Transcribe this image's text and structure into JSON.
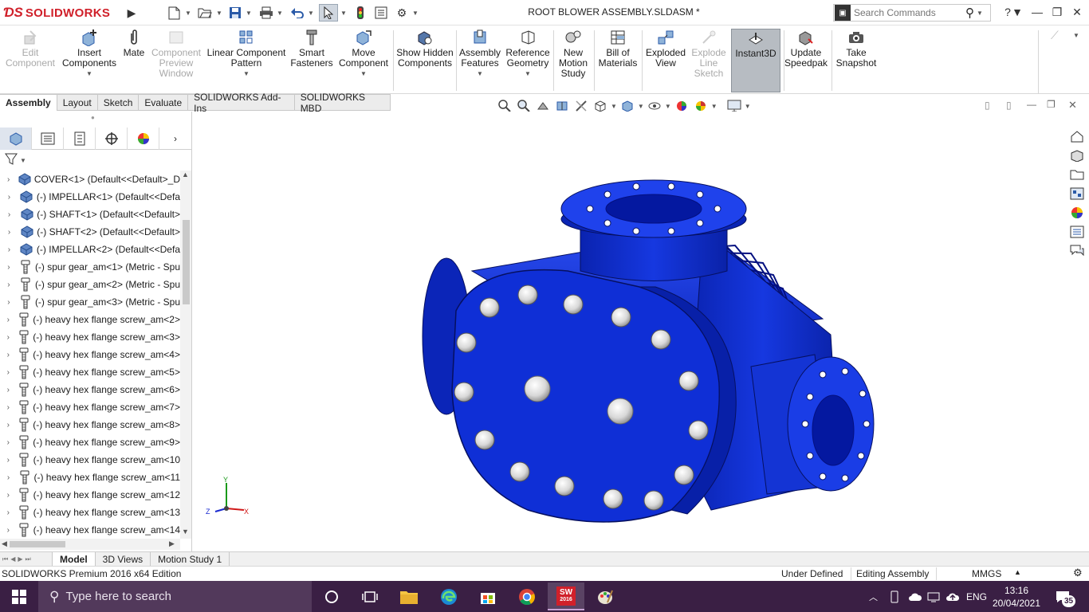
{
  "window": {
    "brand": "SOLIDWORKS",
    "document_title": "ROOT BLOWER ASSEMBLY.SLDASM *",
    "search_placeholder": "Search Commands",
    "help_label": "?"
  },
  "command_manager": [
    {
      "id": "edit-component",
      "label": "Edit Component",
      "enabled": false
    },
    {
      "id": "insert-components",
      "label": "Insert Components",
      "enabled": true,
      "dropdown": true
    },
    {
      "id": "mate",
      "label": "Mate",
      "enabled": true
    },
    {
      "id": "component-preview-window",
      "label": "Component Preview Window",
      "enabled": false
    },
    {
      "id": "linear-component-pattern",
      "label": "Linear Component Pattern",
      "enabled": true,
      "dropdown": true
    },
    {
      "id": "smart-fasteners",
      "label": "Smart Fasteners",
      "enabled": true
    },
    {
      "id": "move-component",
      "label": "Move Component",
      "enabled": true,
      "dropdown": true
    },
    {
      "id": "show-hidden-components",
      "label": "Show Hidden Components",
      "enabled": true
    },
    {
      "id": "assembly-features",
      "label": "Assembly Features",
      "enabled": true,
      "dropdown": true
    },
    {
      "id": "reference-geometry",
      "label": "Reference Geometry",
      "enabled": true,
      "dropdown": true
    },
    {
      "id": "new-motion-study",
      "label": "New Motion Study",
      "enabled": true
    },
    {
      "id": "bill-of-materials",
      "label": "Bill of Materials",
      "enabled": true
    },
    {
      "id": "exploded-view",
      "label": "Exploded View",
      "enabled": true
    },
    {
      "id": "explode-line-sketch",
      "label": "Explode Line Sketch",
      "enabled": false
    },
    {
      "id": "instant3d",
      "label": "Instant3D",
      "enabled": true,
      "active": true
    },
    {
      "id": "update-speedpak",
      "label": "Update Speedpak",
      "enabled": true
    },
    {
      "id": "take-snapshot",
      "label": "Take Snapshot",
      "enabled": true
    }
  ],
  "tabs": [
    {
      "label": "Assembly",
      "active": true
    },
    {
      "label": "Layout"
    },
    {
      "label": "Sketch"
    },
    {
      "label": "Evaluate"
    },
    {
      "label": "SOLIDWORKS Add-Ins"
    },
    {
      "label": "SOLIDWORKS MBD"
    }
  ],
  "feature_tree": [
    {
      "label": "COVER<1> (Default<<Default>_D",
      "icon": "part-icon"
    },
    {
      "label": "(-) IMPELLAR<1> (Default<<Defa",
      "icon": "part-icon"
    },
    {
      "label": "(-) SHAFT<1> (Default<<Default>",
      "icon": "part-icon"
    },
    {
      "label": "(-) SHAFT<2> (Default<<Default>",
      "icon": "part-icon"
    },
    {
      "label": "(-) IMPELLAR<2> (Default<<Defa",
      "icon": "part-icon"
    },
    {
      "label": "(-) spur gear_am<1> (Metric - Spu",
      "icon": "toolbox-icon"
    },
    {
      "label": "(-) spur gear_am<2> (Metric - Spu",
      "icon": "toolbox-icon"
    },
    {
      "label": "(-) spur gear_am<3> (Metric - Spu",
      "icon": "toolbox-icon"
    },
    {
      "label": "(-) heavy hex flange screw_am<2>",
      "icon": "toolbox-icon"
    },
    {
      "label": "(-) heavy hex flange screw_am<3>",
      "icon": "toolbox-icon"
    },
    {
      "label": "(-) heavy hex flange screw_am<4>",
      "icon": "toolbox-icon"
    },
    {
      "label": "(-) heavy hex flange screw_am<5>",
      "icon": "toolbox-icon"
    },
    {
      "label": "(-) heavy hex flange screw_am<6>",
      "icon": "toolbox-icon"
    },
    {
      "label": "(-) heavy hex flange screw_am<7>",
      "icon": "toolbox-icon"
    },
    {
      "label": "(-) heavy hex flange screw_am<8>",
      "icon": "toolbox-icon"
    },
    {
      "label": "(-) heavy hex flange screw_am<9>",
      "icon": "toolbox-icon"
    },
    {
      "label": "(-) heavy hex flange screw_am<10",
      "icon": "toolbox-icon"
    },
    {
      "label": "(-) heavy hex flange screw_am<11",
      "icon": "toolbox-icon"
    },
    {
      "label": "(-) heavy hex flange screw_am<12",
      "icon": "toolbox-icon"
    },
    {
      "label": "(-) heavy hex flange screw_am<13",
      "icon": "toolbox-icon"
    },
    {
      "label": "(-) heavy hex flange screw_am<14",
      "icon": "toolbox-icon"
    }
  ],
  "triad": {
    "x": "X",
    "y": "Y",
    "z": "Z"
  },
  "bottom_tabs": [
    {
      "label": "Model",
      "active": true
    },
    {
      "label": "3D Views"
    },
    {
      "label": "Motion Study 1"
    }
  ],
  "status": {
    "edition": "SOLIDWORKS Premium 2016 x64 Edition",
    "definition": "Under Defined",
    "mode": "Editing Assembly",
    "units": "MMGS"
  },
  "taskbar": {
    "search_placeholder": "Type here to search",
    "language": "ENG",
    "time": "13:16",
    "date": "20/04/2021",
    "notification_count": "35",
    "solidworks_badge": "2016"
  },
  "colors": {
    "model_blue": "#1030d8",
    "brand_red": "#d0202a",
    "taskbar": "#3a1f44",
    "active_button": "#b7bcc2"
  }
}
